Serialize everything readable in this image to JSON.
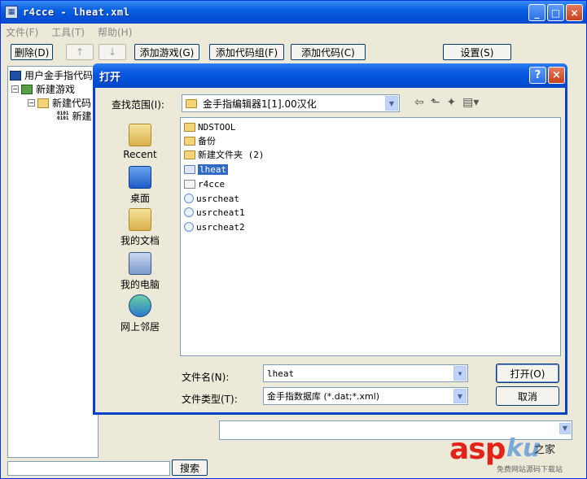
{
  "main": {
    "title": "r4cce - lheat.xml",
    "menu": [
      "文件(F)",
      "工具(T)",
      "帮助(H)"
    ],
    "toolbar": {
      "delete": "删除(D)",
      "up": "↑",
      "down": "↓",
      "add_game": "添加游戏(G)",
      "add_code_group": "添加代码组(F)",
      "add_code": "添加代码(C)",
      "settings": "设置(S)"
    },
    "tree": {
      "root": "用户金手指代码",
      "game": "新建游戏",
      "code_group": "新建代码",
      "code": "新建",
      "bin_icon": "0101\n0101"
    },
    "search_button": "搜索"
  },
  "dialog": {
    "title": "打开",
    "help_glyph": "?",
    "close_glyph": "×",
    "look_in_label": "查找范围(I):",
    "look_in_value": "金手指编辑器1[1].00汉化",
    "places": [
      "Recent",
      "桌面",
      "我的文档",
      "我的电脑",
      "网上邻居"
    ],
    "files": [
      {
        "name": "NDSTOOL",
        "kind": "folder"
      },
      {
        "name": "备份",
        "kind": "folder"
      },
      {
        "name": "新建文件夹 (2)",
        "kind": "folder"
      },
      {
        "name": "lheat",
        "kind": "xml",
        "selected": true
      },
      {
        "name": "r4cce",
        "kind": "txt"
      },
      {
        "name": "usrcheat",
        "kind": "dat"
      },
      {
        "name": "usrcheat1",
        "kind": "dat"
      },
      {
        "name": "usrcheat2",
        "kind": "dat"
      }
    ],
    "filename_label": "文件名(N):",
    "filename_value": "lheat",
    "filetype_label": "文件类型(T):",
    "filetype_value": "金手指数据库 (*.dat;*.xml)",
    "open_button": "打开(O)",
    "cancel_button": "取消"
  },
  "watermark": {
    "brand": "asp",
    "ku": "ku",
    "cn": "之家",
    "sub": "免费网站源码下载站"
  }
}
